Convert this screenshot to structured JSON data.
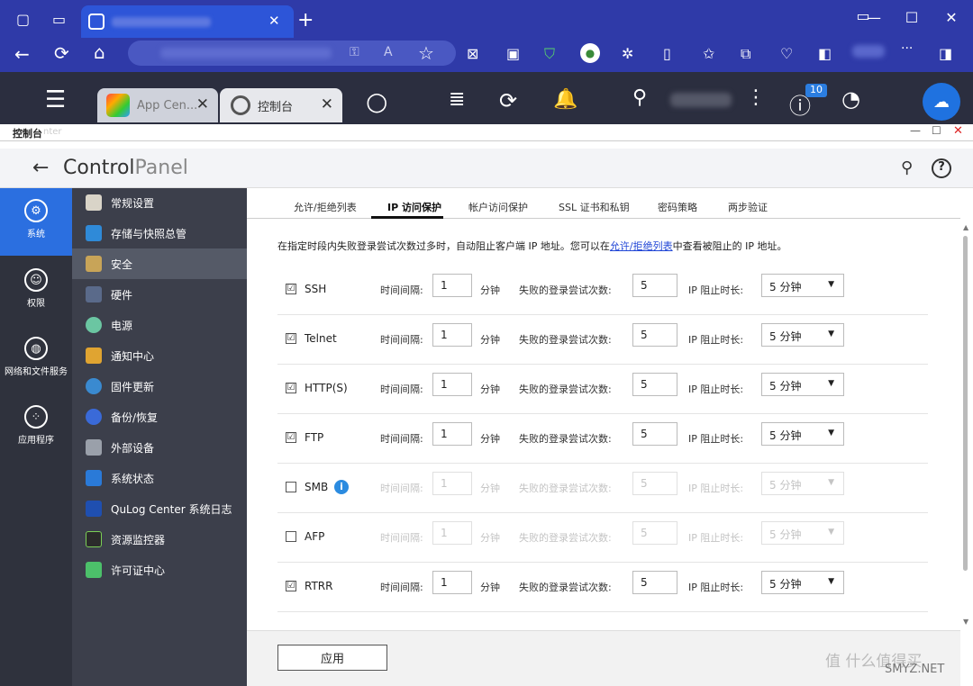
{
  "browser": {
    "back": "←",
    "reload": "⟳",
    "home": "⌂",
    "star": "☆",
    "min": "—",
    "max": "☐",
    "close": "✕",
    "newtab": "+",
    "more": "···"
  },
  "qts": {
    "tabs": [
      {
        "label": "App Cen..."
      },
      {
        "label": "控制台"
      }
    ],
    "badge": "10"
  },
  "window": {
    "title": "控制台",
    "title_suffix": "nter"
  },
  "cp": {
    "title_a": "Control",
    "title_b": "Panel"
  },
  "categories": [
    {
      "label": "系统"
    },
    {
      "label": "权限"
    },
    {
      "label": "网络和文件服务"
    },
    {
      "label": "应用程序"
    }
  ],
  "sidebar": [
    {
      "label": "常规设置"
    },
    {
      "label": "存储与快照总管"
    },
    {
      "label": "安全"
    },
    {
      "label": "硬件"
    },
    {
      "label": "电源"
    },
    {
      "label": "通知中心"
    },
    {
      "label": "固件更新"
    },
    {
      "label": "备份/恢复"
    },
    {
      "label": "外部设备"
    },
    {
      "label": "系统状态"
    },
    {
      "label": "QuLog Center 系统日志"
    },
    {
      "label": "资源监控器"
    },
    {
      "label": "许可证中心"
    }
  ],
  "tabs": [
    {
      "label": "允许/拒绝列表"
    },
    {
      "label": "IP 访问保护"
    },
    {
      "label": "帐户访问保护"
    },
    {
      "label": "SSL 证书和私钥"
    },
    {
      "label": "密码策略"
    },
    {
      "label": "两步验证"
    }
  ],
  "desc": {
    "pre": "在指定时段内失败登录尝试次数过多时，自动阻止客户端 IP 地址。您可以在",
    "link": "允许/拒绝列表",
    "post": "中查看被阻止的 IP 地址。"
  },
  "labels": {
    "interval": "时间间隔:",
    "minute": "分钟",
    "attempts": "失败的登录尝试次数:",
    "block": "IP 阻止时长:"
  },
  "rows": [
    {
      "service": "SSH",
      "checked": "☑",
      "interval": "1",
      "attempts": "5",
      "block": "5 分钟"
    },
    {
      "service": "Telnet",
      "checked": "☑",
      "interval": "1",
      "attempts": "5",
      "block": "5 分钟"
    },
    {
      "service": "HTTP(S)",
      "checked": "☑",
      "interval": "1",
      "attempts": "5",
      "block": "5 分钟"
    },
    {
      "service": "FTP",
      "checked": "☑",
      "interval": "1",
      "attempts": "5",
      "block": "5 分钟"
    },
    {
      "service": "SMB",
      "checked": "",
      "interval": "1",
      "attempts": "5",
      "block": "5 分钟",
      "info": "i"
    },
    {
      "service": "AFP",
      "checked": "",
      "interval": "1",
      "attempts": "5",
      "block": "5 分钟"
    },
    {
      "service": "RTRR",
      "checked": "☑",
      "interval": "1",
      "attempts": "5",
      "block": "5 分钟"
    }
  ],
  "footer": {
    "apply": "应用"
  },
  "watermark": {
    "a": "值 什么值得买",
    "b": "SMYZ.NET"
  },
  "colors": {
    "browser": "#2f3aa8",
    "active_tab": "#2d55d8",
    "qts_bar": "#2b2e3f",
    "sidebar": "#3c3f4b",
    "link": "#2146d6"
  }
}
